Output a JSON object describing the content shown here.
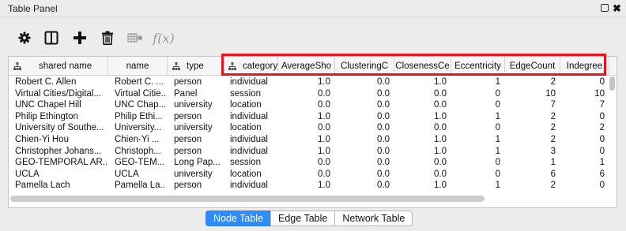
{
  "window": {
    "title": "Table Panel"
  },
  "toolbar": {
    "items": [
      {
        "icon": "gear-icon"
      },
      {
        "icon": "columns-icon"
      },
      {
        "icon": "plus-icon"
      },
      {
        "icon": "trash-icon"
      },
      {
        "icon": "link-table-icon"
      },
      {
        "icon": "function-builder-icon",
        "label": "f(x)"
      }
    ]
  },
  "table": {
    "columns": [
      {
        "label": "shared name",
        "tree_icon": true
      },
      {
        "label": "name",
        "tree_icon": false
      },
      {
        "label": "type",
        "tree_icon": true
      },
      {
        "label": "category",
        "tree_icon": true
      },
      {
        "label": "AverageSho",
        "tree_icon": false
      },
      {
        "label": "ClusteringC",
        "tree_icon": false
      },
      {
        "label": "ClosenessCe",
        "tree_icon": false
      },
      {
        "label": "Eccentricity",
        "tree_icon": false
      },
      {
        "label": "EdgeCount",
        "tree_icon": false
      },
      {
        "label": "Indegree",
        "tree_icon": false
      }
    ],
    "rows": [
      [
        "Robert C. Allen",
        "Robert C. ...",
        "person",
        "individual",
        "1.0",
        "0.0",
        "1.0",
        "1",
        "2",
        "0"
      ],
      [
        "Virtual Cities/Digital...",
        "Virtual Citie...",
        "Panel",
        "session",
        "0.0",
        "0.0",
        "0.0",
        "0",
        "10",
        "10"
      ],
      [
        "UNC Chapel Hill",
        "UNC Chap...",
        "university",
        "location",
        "0.0",
        "0.0",
        "0.0",
        "0",
        "7",
        "7"
      ],
      [
        "Philip Ethington",
        "Philip Ethi...",
        "person",
        "individual",
        "1.0",
        "0.0",
        "1.0",
        "1",
        "2",
        "0"
      ],
      [
        "University of Southe...",
        "University...",
        "university",
        "location",
        "0.0",
        "0.0",
        "0.0",
        "0",
        "2",
        "2"
      ],
      [
        "Chien-Yi Hou",
        "Chien-Yi ...",
        "person",
        "individual",
        "1.0",
        "0.0",
        "1.0",
        "1",
        "2",
        "0"
      ],
      [
        "Christopher Johans...",
        "Christoph...",
        "person",
        "individual",
        "1.0",
        "0.0",
        "1.0",
        "1",
        "3",
        "0"
      ],
      [
        "GEO-TEMPORAL AR...",
        "GEO-TEM...",
        "Long Pap...",
        "session",
        "0.0",
        "0.0",
        "0.0",
        "0",
        "1",
        "1"
      ],
      [
        "UCLA",
        "UCLA",
        "university",
        "location",
        "0.0",
        "0.0",
        "0.0",
        "0",
        "6",
        "6"
      ],
      [
        "Pamella Lach",
        "Pamella La...",
        "person",
        "individual",
        "1.0",
        "0.0",
        "1.0",
        "1",
        "2",
        "0"
      ]
    ]
  },
  "tabs": [
    {
      "label": "Node Table",
      "active": true
    },
    {
      "label": "Edge Table",
      "active": false
    },
    {
      "label": "Network Table",
      "active": false
    }
  ],
  "colors": {
    "highlight": "#e8131c",
    "active_tab": "#2e8dfb"
  }
}
